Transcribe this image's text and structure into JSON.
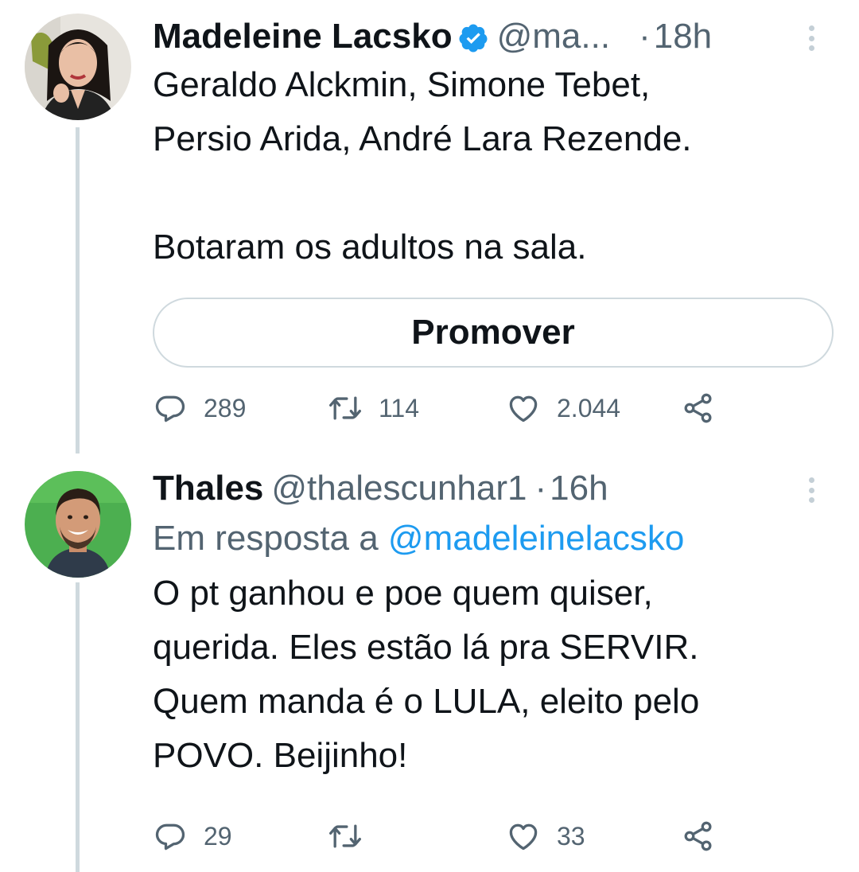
{
  "tweets": [
    {
      "display_name": "Madeleine Lacsko",
      "verified": true,
      "handle": "@ma...",
      "separator": "·",
      "time": "18h",
      "text": "Geraldo Alckmin, Simone Tebet,\nPersio Arida, André Lara Rezende.\n\nBotaram os adultos na sala.",
      "promote_label": "Promover",
      "replies": "289",
      "retweets": "114",
      "likes": "2.044"
    },
    {
      "display_name": "Thales",
      "handle": "@thalescunhar1",
      "separator": "·",
      "time": "16h",
      "reply_prefix": "Em resposta a",
      "reply_mention": "@madeleinelacsko",
      "text": "O pt ganhou e poe quem quiser,\nquerida. Eles estão lá pra SERVIR.\nQuem manda é o LULA, eleito pelo\nPOVO. Beijinho!",
      "replies": "29",
      "retweets": "",
      "likes": "33"
    }
  ],
  "icons": {
    "reply": "reply-icon",
    "retweet": "retweet-icon",
    "like": "heart-icon",
    "share": "share-icon",
    "verified": "verified-badge-icon",
    "more": "more-options-icon"
  },
  "colors": {
    "text": "#0f1419",
    "secondary": "#536471",
    "link": "#1d9bf0",
    "border": "#cfd9de"
  }
}
